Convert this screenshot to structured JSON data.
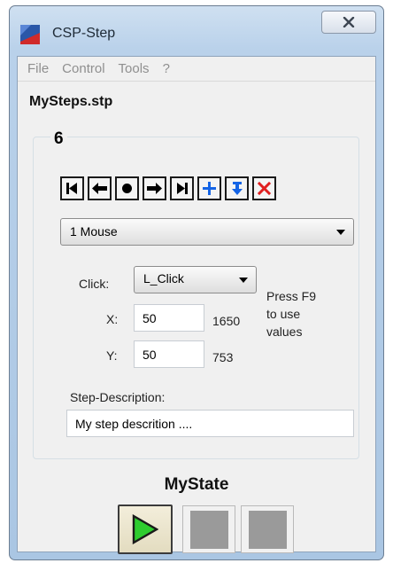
{
  "window": {
    "title": "CSP-Step",
    "close_label": "X"
  },
  "menu": {
    "items": [
      "File",
      "Control",
      "Tools",
      "?"
    ]
  },
  "file_name": "MySteps.stp",
  "step_number": "6",
  "step_type": {
    "selected": "1 Mouse"
  },
  "click": {
    "label": "Click:",
    "selected": "L_Click"
  },
  "x": {
    "label": "X:",
    "value": "50",
    "screen_value": "1650"
  },
  "y": {
    "label": "Y:",
    "value": "50",
    "screen_value": "753"
  },
  "hint": "Press F9 to use values",
  "description": {
    "label": "Step-Description:",
    "value": "My step descrition ...."
  },
  "state": "MyState",
  "colors": {
    "accent_blue": "#1464e6",
    "delete_red": "#e02020",
    "play_green": "#2ecc2e"
  }
}
